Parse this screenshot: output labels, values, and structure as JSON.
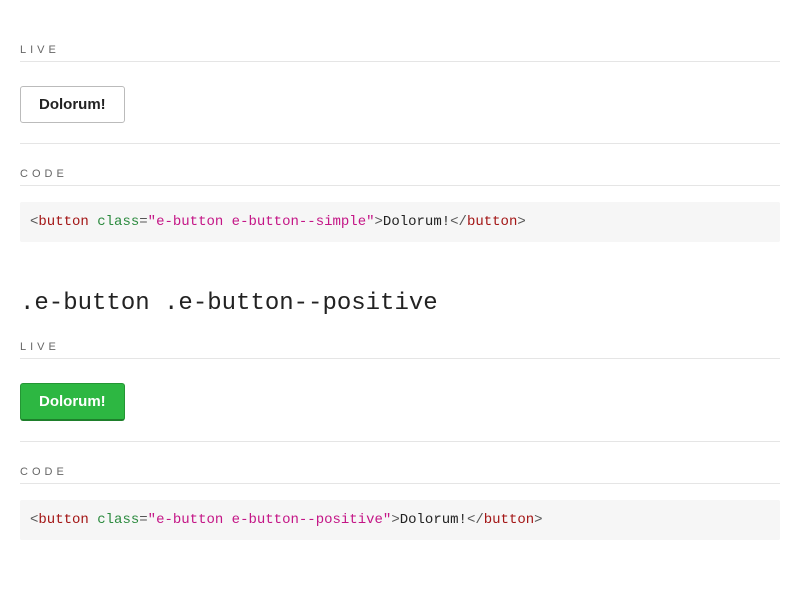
{
  "labels": {
    "live": "LIVE",
    "code": "CODE"
  },
  "sections": [
    {
      "variant": "simple",
      "button_label": "Dolorum!",
      "code": {
        "open_lt": "<",
        "tag": "button",
        "space": " ",
        "attr": "class",
        "eq": "=",
        "q": "\"",
        "class_val": "e-button e-button--simple",
        "gt": ">",
        "content": "Dolorum!",
        "close_lt": "</",
        "close_gt": ">"
      }
    },
    {
      "heading": ".e-button .e-button--positive",
      "variant": "positive",
      "button_label": "Dolorum!",
      "code": {
        "open_lt": "<",
        "tag": "button",
        "space": " ",
        "attr": "class",
        "eq": "=",
        "q": "\"",
        "class_val": "e-button e-button--positive",
        "gt": ">",
        "content": "Dolorum!",
        "close_lt": "</",
        "close_gt": ">"
      }
    }
  ]
}
